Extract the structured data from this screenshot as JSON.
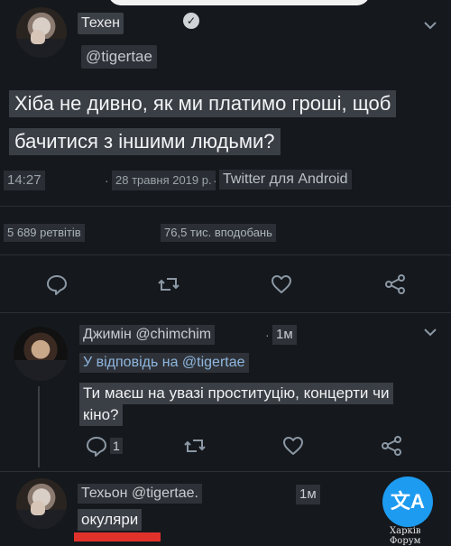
{
  "tweet": {
    "author_name": "Техен",
    "author_handle": "@tigertae",
    "text_lines": [
      "Хіба не дивно, як ми платимо гроші, щоб",
      "бачитися з іншими людьми?"
    ],
    "time": "14:27",
    "date": "28 травня 2019 р.",
    "source": "Twitter для Android",
    "retweets": "5 689 ретвітів",
    "likes": "76,5 тис. вподобань"
  },
  "replies": [
    {
      "author": "Джимін @chimchim",
      "time": "1м",
      "reply_to": "У відповідь на @tigertae",
      "text_lines": [
        "Ти маєш на увазі проституцію, концерти чи",
        "кіно?"
      ],
      "reply_count": "1"
    },
    {
      "author": "Техьон @tigertae.",
      "time": "1м",
      "text_lines": [
        "окуляри"
      ]
    }
  ],
  "translate_button": {
    "label": "文A"
  },
  "watermark": "Харків Форум",
  "icons": {
    "verified": "verified-badge",
    "menu": "chevron-down",
    "reply": "reply-bubble",
    "retweet": "retweet-arrows",
    "like": "heart",
    "share": "share-network",
    "translate": "translate"
  },
  "colors": {
    "background": "#15181c",
    "accent": "#1d9bf0",
    "link": "#8fb7e0"
  }
}
